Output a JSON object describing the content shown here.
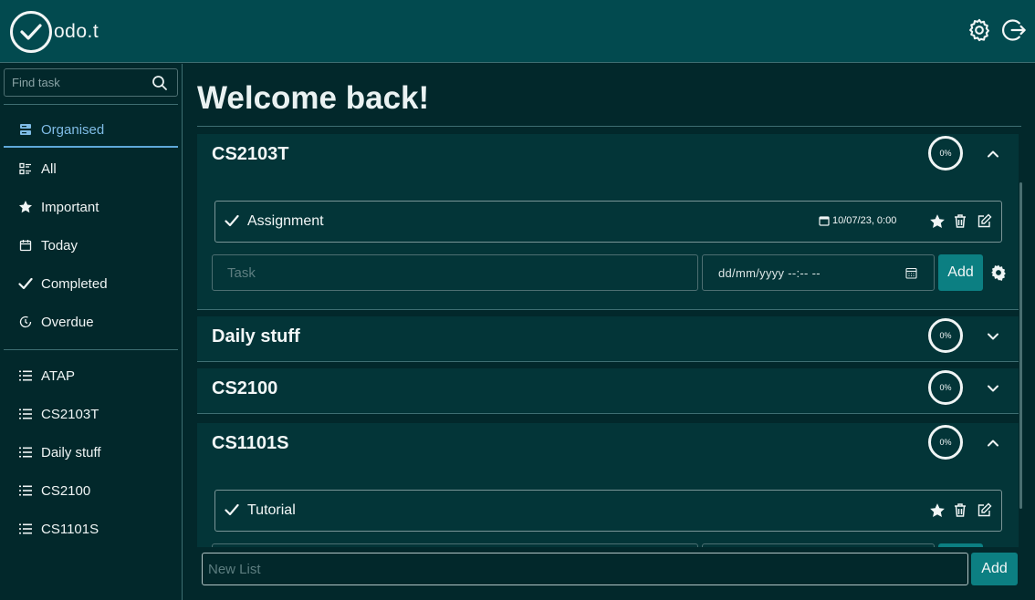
{
  "app": {
    "logo_text": "odo.t"
  },
  "header": {
    "icons": [
      "check-logo-icon",
      "gear-icon",
      "logout-icon"
    ]
  },
  "sidebar": {
    "search_placeholder": "Find task",
    "nav": [
      {
        "label": "Organised",
        "icon": "organised-icon",
        "active": true
      },
      {
        "label": "All",
        "icon": "list-details-icon"
      },
      {
        "label": "Important",
        "icon": "star-icon"
      },
      {
        "label": "Today",
        "icon": "calendar-icon"
      },
      {
        "label": "Completed",
        "icon": "check-icon"
      },
      {
        "label": "Overdue",
        "icon": "clock-icon"
      }
    ],
    "lists": [
      {
        "label": "ATAP",
        "icon": "list-icon"
      },
      {
        "label": "CS2103T",
        "icon": "list-icon"
      },
      {
        "label": "Daily stuff",
        "icon": "list-icon"
      },
      {
        "label": "CS2100",
        "icon": "list-icon"
      },
      {
        "label": "CS1101S",
        "icon": "list-icon"
      }
    ]
  },
  "main": {
    "welcome": "Welcome back!",
    "lists": [
      {
        "title": "CS2103T",
        "progress": "0%",
        "expanded": true,
        "tasks": [
          {
            "name": "Assignment",
            "due": "10/07/23, 0:00"
          }
        ],
        "task_placeholder": "Task",
        "date_placeholder": "dd/mm/yyyy --:-- --",
        "add_label": "Add"
      },
      {
        "title": "Daily stuff",
        "progress": "0%",
        "expanded": false
      },
      {
        "title": "CS2100",
        "progress": "0%",
        "expanded": false
      },
      {
        "title": "CS1101S",
        "progress": "0%",
        "expanded": true,
        "tasks": [
          {
            "name": "Tutorial",
            "due": ""
          }
        ]
      }
    ],
    "new_list_placeholder": "New List",
    "new_list_add": "Add"
  },
  "colors": {
    "header_bg": "#024a4f",
    "page_bg": "#02282b",
    "card_bg": "#033538",
    "accent": "#0c7f82",
    "active_nav": "#7fbce6"
  }
}
